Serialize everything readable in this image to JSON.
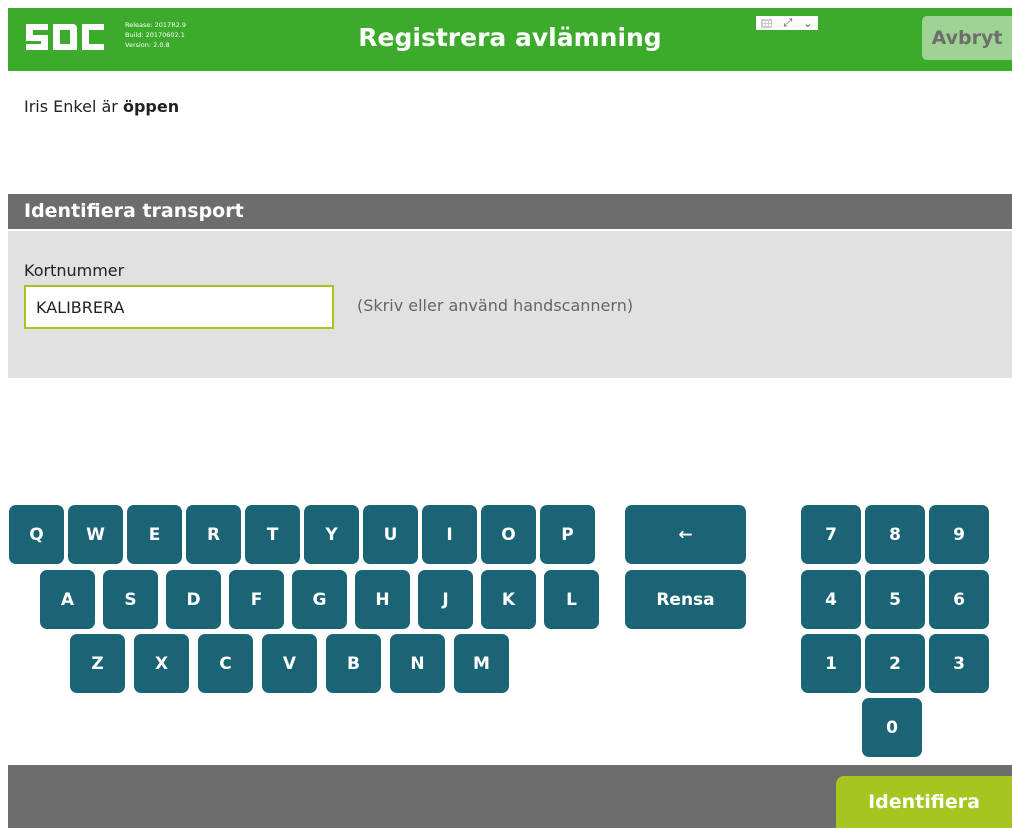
{
  "header": {
    "title": "Registrera avlämning",
    "logo_text": "SDC",
    "release": "Release: 2017R2.9",
    "build": "Build: 20170602.1",
    "version": "Version: 2.0.8",
    "cancel_label": "Avbryt",
    "colors": {
      "bar": "#3cab2b",
      "cancel_bg": "#9fd394"
    }
  },
  "status": {
    "prefix": "Iris Enkel är ",
    "state": "öppen"
  },
  "identify_section": {
    "title": "Identifiera transport",
    "field_label": "Kortnummer",
    "field_value": "KALIBRERA",
    "hint": "(Skriv eller använd handscannern)"
  },
  "keyboard": {
    "row1": [
      "Q",
      "W",
      "E",
      "R",
      "T",
      "Y",
      "U",
      "I",
      "O",
      "P"
    ],
    "row2": [
      "A",
      "S",
      "D",
      "F",
      "G",
      "H",
      "J",
      "K",
      "L"
    ],
    "row3": [
      "Z",
      "X",
      "C",
      "V",
      "B",
      "N",
      "M"
    ],
    "backspace": "←",
    "clear": "Rensa",
    "numpad": [
      "7",
      "8",
      "9",
      "4",
      "5",
      "6",
      "1",
      "2",
      "3",
      "0"
    ],
    "key_color": "#1b6475"
  },
  "footer": {
    "identify_label": "Identifiera",
    "button_color": "#a6c51e"
  }
}
